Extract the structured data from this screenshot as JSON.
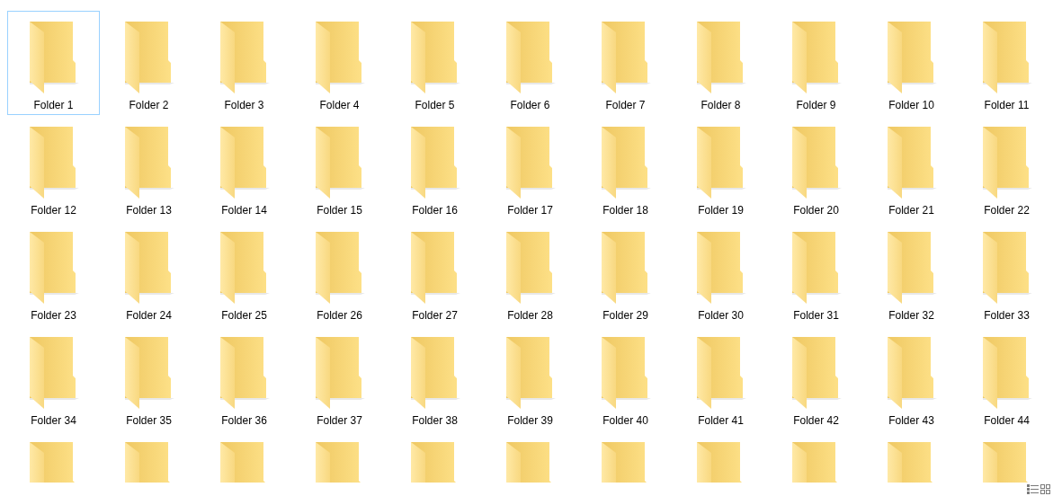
{
  "folders": [
    {
      "name": "Folder 1",
      "selected": true
    },
    {
      "name": "Folder 2",
      "selected": false
    },
    {
      "name": "Folder 3",
      "selected": false
    },
    {
      "name": "Folder 4",
      "selected": false
    },
    {
      "name": "Folder 5",
      "selected": false
    },
    {
      "name": "Folder 6",
      "selected": false
    },
    {
      "name": "Folder 7",
      "selected": false
    },
    {
      "name": "Folder 8",
      "selected": false
    },
    {
      "name": "Folder 9",
      "selected": false
    },
    {
      "name": "Folder 10",
      "selected": false
    },
    {
      "name": "Folder 11",
      "selected": false
    },
    {
      "name": "Folder 12",
      "selected": false
    },
    {
      "name": "Folder 13",
      "selected": false
    },
    {
      "name": "Folder 14",
      "selected": false
    },
    {
      "name": "Folder 15",
      "selected": false
    },
    {
      "name": "Folder 16",
      "selected": false
    },
    {
      "name": "Folder 17",
      "selected": false
    },
    {
      "name": "Folder 18",
      "selected": false
    },
    {
      "name": "Folder 19",
      "selected": false
    },
    {
      "name": "Folder 20",
      "selected": false
    },
    {
      "name": "Folder 21",
      "selected": false
    },
    {
      "name": "Folder 22",
      "selected": false
    },
    {
      "name": "Folder 23",
      "selected": false
    },
    {
      "name": "Folder 24",
      "selected": false
    },
    {
      "name": "Folder 25",
      "selected": false
    },
    {
      "name": "Folder 26",
      "selected": false
    },
    {
      "name": "Folder 27",
      "selected": false
    },
    {
      "name": "Folder 28",
      "selected": false
    },
    {
      "name": "Folder 29",
      "selected": false
    },
    {
      "name": "Folder 30",
      "selected": false
    },
    {
      "name": "Folder 31",
      "selected": false
    },
    {
      "name": "Folder 32",
      "selected": false
    },
    {
      "name": "Folder 33",
      "selected": false
    },
    {
      "name": "Folder 34",
      "selected": false
    },
    {
      "name": "Folder 35",
      "selected": false
    },
    {
      "name": "Folder 36",
      "selected": false
    },
    {
      "name": "Folder 37",
      "selected": false
    },
    {
      "name": "Folder 38",
      "selected": false
    },
    {
      "name": "Folder 39",
      "selected": false
    },
    {
      "name": "Folder 40",
      "selected": false
    },
    {
      "name": "Folder 41",
      "selected": false
    },
    {
      "name": "Folder 42",
      "selected": false
    },
    {
      "name": "Folder 43",
      "selected": false
    },
    {
      "name": "Folder 44",
      "selected": false
    },
    {
      "selected": false
    },
    {
      "selected": false
    },
    {
      "selected": false
    },
    {
      "selected": false
    },
    {
      "selected": false
    },
    {
      "selected": false
    },
    {
      "selected": false
    },
    {
      "selected": false
    },
    {
      "selected": false
    },
    {
      "selected": false
    },
    {
      "selected": false
    }
  ],
  "view_buttons": [
    {
      "kind": "details"
    },
    {
      "kind": "large_icons"
    }
  ]
}
